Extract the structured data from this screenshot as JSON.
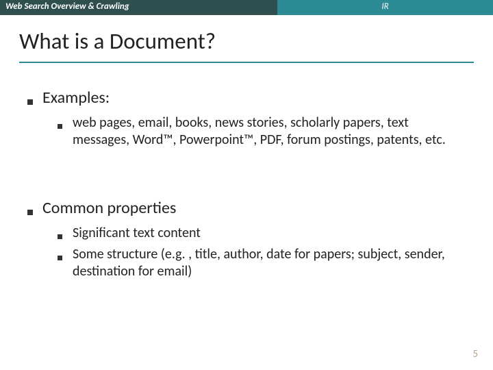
{
  "header": {
    "left": "Web Search Overview & Crawling",
    "right": "IR"
  },
  "title": "What is a Document?",
  "bullets": {
    "b1": "Examples:",
    "b1a": "web pages, email, books, news stories, scholarly papers, text messages, Word™, Powerpoint™, PDF, forum postings, patents, etc.",
    "b2": "Common properties",
    "b2a": "Significant text content",
    "b2b": "Some structure (e.g. , title, author, date for papers; subject, sender, destination for email)"
  },
  "page_number": "5"
}
